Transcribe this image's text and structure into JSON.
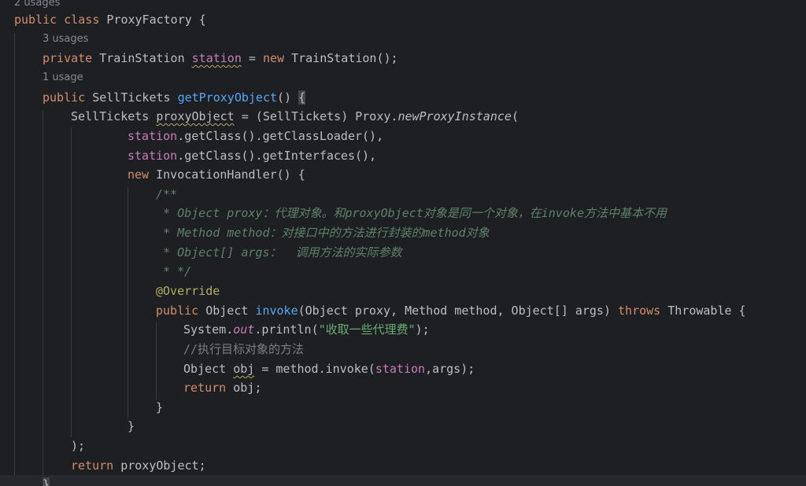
{
  "editor": {
    "theme": {
      "background": "#1e1f22",
      "current_line": "#26282e"
    },
    "usages": {
      "class": "2 usages",
      "field": "3 usages",
      "method": "1 usage"
    },
    "code": {
      "public": "public",
      "class": "class",
      "private": "private",
      "new": "new",
      "return": "return",
      "throws": "throws",
      "class_name": "ProxyFactory",
      "train_station": "TrainStation",
      "station": "station",
      "sell_tickets": "SellTickets",
      "get_proxy_object": "getProxyObject",
      "proxy_object": "proxyObject",
      "proxy": "Proxy",
      "new_proxy_instance": "newProxyInstance",
      "get_class": "getClass",
      "get_class_loader": "getClassLoader",
      "get_interfaces": "getInterfaces",
      "invocation_handler": "InvocationHandler",
      "doc_open": "/**",
      "doc_proxy": " * Object proxy：代理对象。和proxyObject对象是同一个对象，在invoke方法中基本不用",
      "doc_method": " * Method method：对接口中的方法进行封装的method对象",
      "doc_args": " * Object[] args：  调用方法的实际参数",
      "doc_close": " * */",
      "override": "@Override",
      "object_type": "Object",
      "invoke": "invoke",
      "invoke_params": "(Object proxy, Method method, Object[] args) ",
      "throwable": "Throwable",
      "system": "System",
      "out": "out",
      "println": "println",
      "fee_string": "\"收取一些代理费\"",
      "exec_comment": "//执行目标对象的方法",
      "obj": "obj",
      "method_invoke": "method.invoke(",
      "args_close": ",args);"
    }
  }
}
